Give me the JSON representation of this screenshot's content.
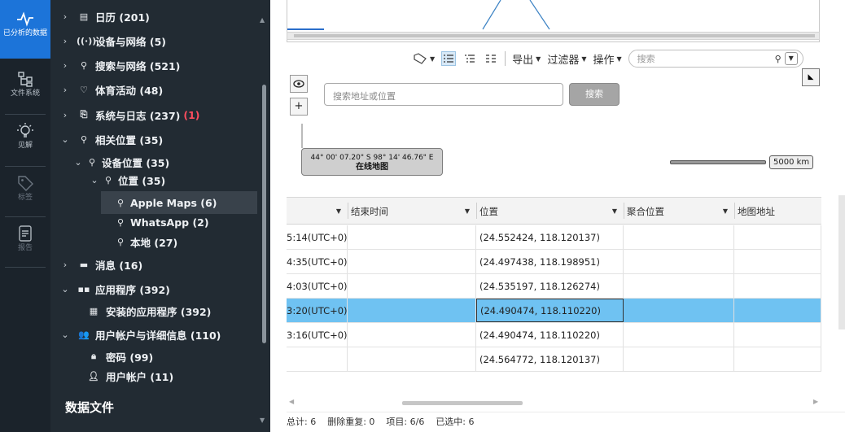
{
  "rail": {
    "items": [
      {
        "label": "已分析的数据",
        "icon": "pulse-icon"
      },
      {
        "label": "文件系统",
        "icon": "filesystem-icon"
      },
      {
        "label": "见解",
        "icon": "lightbulb-icon"
      },
      {
        "label": "标签",
        "icon": "tag-icon"
      },
      {
        "label": "报告",
        "icon": "report-icon"
      }
    ]
  },
  "tree": {
    "nodes": [
      {
        "label": "日历 (201)",
        "icon": "calendar-icon"
      },
      {
        "label": "设备与网络 (5)",
        "icon": "wifi-icon"
      },
      {
        "label": "搜索与网络 (521)",
        "icon": "search-icon"
      },
      {
        "label": "体育活动 (48)",
        "icon": "heart-icon"
      },
      {
        "label": "系统与日志 (237)",
        "red": "(1)",
        "icon": "system-log-icon"
      },
      {
        "label": "相关位置 (35)",
        "icon": "location-pin-icon"
      },
      {
        "label": "设备位置 (35)",
        "icon": "location-pin-icon"
      },
      {
        "label": "位置 (35)",
        "icon": "location-pin-icon"
      },
      {
        "label": "Apple Maps (6)",
        "icon": "location-pin-icon"
      },
      {
        "label": "WhatsApp (2)",
        "icon": "location-pin-icon"
      },
      {
        "label": "本地 (27)",
        "icon": "location-pin-icon"
      },
      {
        "label": "消息 (16)",
        "icon": "message-icon"
      },
      {
        "label": "应用程序 (392)",
        "icon": "apps-grid-icon"
      },
      {
        "label": "安装的应用程序 (392)",
        "icon": "installed-apps-icon"
      },
      {
        "label": "用户帐户与详细信息 (110)",
        "icon": "users-icon"
      },
      {
        "label": "密码 (99)",
        "icon": "lock-icon"
      },
      {
        "label": "用户帐户 (11)",
        "icon": "user-key-icon"
      }
    ],
    "section_title": "数据文件"
  },
  "toolbar": {
    "export": "导出",
    "filter": "过滤器",
    "actions": "操作",
    "search_placeholder": "搜索"
  },
  "map": {
    "address_placeholder": "搜索地址或位置",
    "search_button": "搜索",
    "coord_text": "44° 00' 07.20\" S 98° 14' 46.76\" E",
    "online_map": "在线地图",
    "scale_label": "5000 km"
  },
  "table": {
    "columns": [
      "结束时间",
      "位置",
      "聚合位置",
      "地图地址"
    ],
    "rows": [
      {
        "time": "5:14(UTC+0)",
        "end": "",
        "location": "(24.552424, 118.120137)",
        "agg": "",
        "addr": ""
      },
      {
        "time": "4:35(UTC+0)",
        "end": "",
        "location": "(24.497438, 118.198951)",
        "agg": "",
        "addr": ""
      },
      {
        "time": "4:03(UTC+0)",
        "end": "",
        "location": "(24.535197, 118.126274)",
        "agg": "",
        "addr": ""
      },
      {
        "time": "3:20(UTC+0)",
        "end": "",
        "location": "(24.490474, 118.110220)",
        "agg": "",
        "addr": ""
      },
      {
        "time": "3:16(UTC+0)",
        "end": "",
        "location": "(24.490474, 118.110220)",
        "agg": "",
        "addr": ""
      },
      {
        "time": "",
        "end": "",
        "location": "(24.564772, 118.120137)",
        "agg": "",
        "addr": ""
      }
    ],
    "selected_row": 3
  },
  "status": {
    "total": "总计: 6",
    "dedup": "删除重复: 0",
    "items": "项目: 6/6",
    "selected": "已选中: 6"
  },
  "colors": {
    "rail_bg": "#1b232b",
    "tree_bg": "#222b33",
    "active_blue": "#1c74d9",
    "row_selected": "#6fc2f2",
    "badge_red": "#ff4d5e"
  }
}
